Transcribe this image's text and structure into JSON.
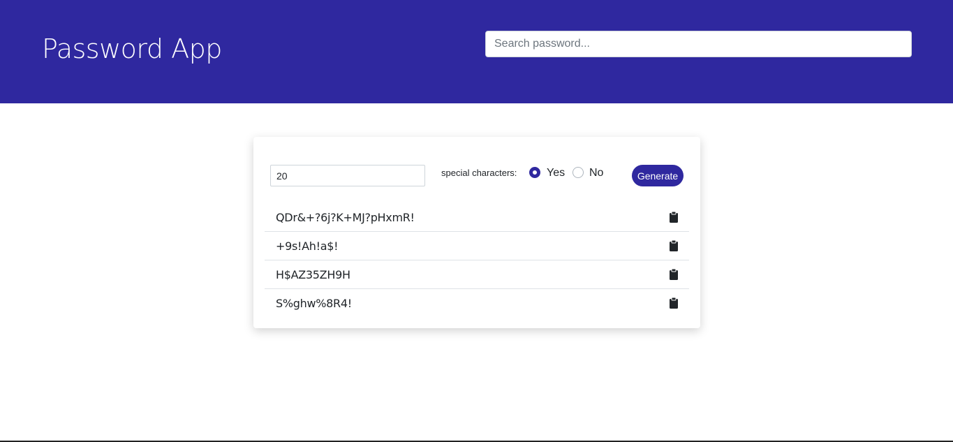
{
  "header": {
    "title": "Password App",
    "search_placeholder": "Search password..."
  },
  "generator": {
    "length_value": "20",
    "special_label": "special characters:",
    "options": [
      {
        "label": "Yes",
        "selected": true
      },
      {
        "label": "No",
        "selected": false
      }
    ],
    "generate_label": "Generate"
  },
  "passwords": [
    {
      "value": "QDr&+?6j?K+MJ?pHxmR!",
      "icon": "clipboard-icon"
    },
    {
      "value": "+9s!Ah!a$!",
      "icon": "clipboard-icon"
    },
    {
      "value": "H$AZ35ZH9H",
      "icon": "clipboard-icon"
    },
    {
      "value": "S%ghw%8R4!",
      "icon": "clipboard-icon"
    }
  ],
  "colors": {
    "brand": "#2f289f",
    "header_bg": "#2f289f"
  }
}
